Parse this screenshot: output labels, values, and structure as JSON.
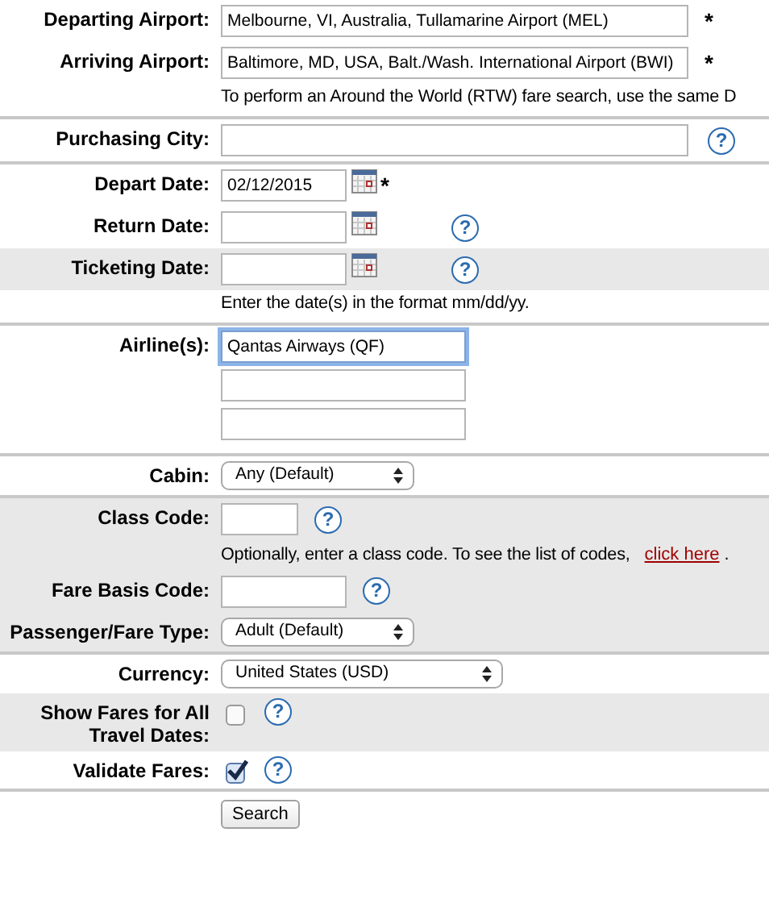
{
  "rows": [
    {
      "kind": "long_text",
      "label": "Departing Airport:",
      "value": "Melbourne, VI, Australia, Tullamarine Airport (MEL)",
      "required": "*"
    },
    {
      "kind": "long_text",
      "label": "Arriving Airport:",
      "value": "Baltimore, MD, USA, Balt./Wash. International Airport (BWI)",
      "required": "*"
    },
    {
      "kind": "note",
      "text": "To perform an Around the World (RTW) fare search, use the same D",
      "divider_after": true
    },
    {
      "kind": "long_text",
      "label": "Purchasing City:",
      "help": "?",
      "divider_after": true
    },
    {
      "kind": "date",
      "label": "Depart Date:",
      "value": "02/12/2015",
      "required": "*"
    },
    {
      "kind": "date",
      "label": "Return Date:",
      "help": "?"
    },
    {
      "kind": "date",
      "label": "Ticketing Date:",
      "help": "?",
      "shaded": true
    },
    {
      "kind": "note",
      "text": "Enter the date(s) in the format mm/dd/yy.",
      "divider_after": true
    },
    {
      "kind": "airlines",
      "label": "Airline(s):",
      "fields": [
        {
          "value": "Qantas Airways (QF)",
          "focused": true
        },
        {
          "focused": false
        },
        {
          "focused": false
        }
      ],
      "divider_after": true
    },
    {
      "kind": "select",
      "label": "Cabin:",
      "value": "Any (Default)",
      "divider_after": true
    },
    {
      "kind": "short_text",
      "label": "Class Code:",
      "help": "?",
      "shaded": true
    },
    {
      "kind": "note",
      "text": "Optionally, enter a class code. To see the list of codes,",
      "link": "click here",
      "tail": ".",
      "shaded": true
    },
    {
      "kind": "medium_text",
      "label": "Fare Basis Code:",
      "help": "?",
      "shaded": true
    },
    {
      "kind": "select",
      "label": "Passenger/Fare Type:",
      "value": "Adult (Default)",
      "shaded": true,
      "divider_after": true
    },
    {
      "kind": "wide_select",
      "label": "Currency:",
      "value": "United States (USD)"
    },
    {
      "kind": "check",
      "label": "Show Fares for All Travel Dates:",
      "checked": false,
      "help": "?",
      "shaded": true
    },
    {
      "kind": "check",
      "label": "Validate Fares:",
      "checked": true,
      "help": "?",
      "divider_after": true
    },
    {
      "kind": "button",
      "text": "Search"
    }
  ]
}
